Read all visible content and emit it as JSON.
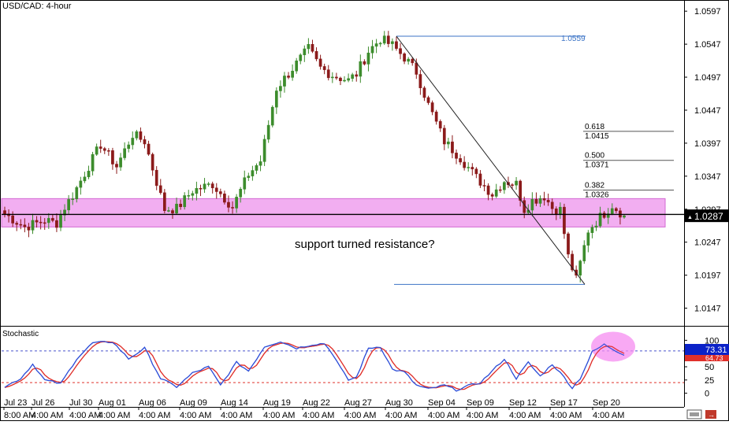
{
  "header": {
    "title": "USD/CAD: 4-hour"
  },
  "sub_panel": {
    "title": "Stochastic"
  },
  "annotation": "support turned resistance?",
  "colors": {
    "bull": "#3c8c2c",
    "bear": "#8b1a1a",
    "zone": "#f0a0ef",
    "zone_border": "#d36ad3",
    "fib_line": "#555555",
    "swing_line": "#3b73c6",
    "stoch_k": "#2f4fd8",
    "stoch_d": "#e0302a",
    "ob_line": "#4a55cc",
    "os_line": "#e0302a",
    "price_label_bg": "#000000",
    "k_label_bg": "#0b22c8",
    "d_label_bg": "#e0302a",
    "circle": "#f58cf0"
  },
  "chart_data": [
    {
      "type": "candlestick",
      "title": "USD/CAD: 4-hour",
      "y_ticks": [
        "1.0597",
        "1.0547",
        "1.0497",
        "1.0447",
        "1.0397",
        "1.0347",
        "1.0297",
        "1.0247",
        "1.0197",
        "1.0147"
      ],
      "ylim": [
        1.0125,
        1.0602
      ],
      "current_price": "1.0287",
      "support_resistance_line": 1.0289,
      "support_zone": [
        1.027,
        1.0313
      ],
      "swing_high": {
        "label": "1.0559",
        "value": 1.0559
      },
      "swing_low": {
        "value": 1.0183
      },
      "fibonacci": [
        {
          "ratio": "0.618",
          "price": "1.0415"
        },
        {
          "ratio": "0.500",
          "price": "1.0371"
        },
        {
          "ratio": "0.382",
          "price": "1.0326"
        }
      ],
      "x_dates": [
        "Jul 23",
        "Jul 26",
        "Jul 30",
        "Aug 01",
        "Aug 06",
        "Aug 09",
        "Aug 14",
        "Aug 19",
        "Aug 22",
        "Aug 27",
        "Aug 30",
        "Sep 04",
        "Sep 09",
        "Sep 12",
        "Sep 17",
        "Sep 20"
      ],
      "x_times": [
        "8:00 AM",
        "4:00 AM",
        "4:00 AM",
        "4:00 AM",
        "4:00 AM",
        "4:00 AM",
        "4:00 AM",
        "4:00 AM",
        "4:00 AM",
        "4:00 AM",
        "4:00 AM",
        "4:00 AM",
        "4:00 AM",
        "4:00 AM",
        "4:00 AM",
        "4:00 AM"
      ],
      "path_waypoints": [
        [
          0,
          1.029
        ],
        [
          5,
          1.027
        ],
        [
          10,
          1.028
        ],
        [
          13,
          1.0276
        ],
        [
          15,
          1.03
        ],
        [
          17,
          1.0318
        ],
        [
          24,
          1.0395
        ],
        [
          28,
          1.0362
        ],
        [
          32,
          1.041
        ],
        [
          35,
          1.04
        ],
        [
          40,
          1.0297
        ],
        [
          43,
          1.0298
        ],
        [
          47,
          1.0325
        ],
        [
          52,
          1.0335
        ],
        [
          57,
          1.03
        ],
        [
          61,
          1.035
        ],
        [
          64,
          1.037
        ],
        [
          68,
          1.048
        ],
        [
          72,
          1.051
        ],
        [
          76,
          1.054
        ],
        [
          79,
          1.0511
        ],
        [
          82,
          1.05
        ],
        [
          86,
          1.0492
        ],
        [
          88,
          1.0502
        ],
        [
          91,
          1.0536
        ],
        [
          94,
          1.0555
        ],
        [
          97,
          1.0545
        ],
        [
          100,
          1.0527
        ],
        [
          103,
          1.0505
        ],
        [
          106,
          1.0455
        ],
        [
          110,
          1.04
        ],
        [
          114,
          1.0375
        ],
        [
          118,
          1.0345
        ],
        [
          122,
          1.032
        ],
        [
          125,
          1.034
        ],
        [
          128,
          1.0335
        ],
        [
          130,
          1.0297
        ],
        [
          132,
          1.031
        ],
        [
          135,
          1.0317
        ],
        [
          137,
          1.0299
        ],
        [
          139,
          1.0296
        ],
        [
          141,
          1.0225
        ],
        [
          143,
          1.019
        ],
        [
          146,
          1.0265
        ],
        [
          149,
          1.0285
        ],
        [
          152,
          1.0303
        ],
        [
          155,
          1.0287
        ]
      ]
    },
    {
      "type": "line",
      "title": "Stochastic",
      "y_ticks": [
        "100",
        "50",
        "25",
        "0"
      ],
      "ylim": [
        -8,
        108
      ],
      "overbought": 80,
      "oversold": 20,
      "k_label": "73.31",
      "d_label": "64.73",
      "waypoints": [
        [
          0,
          12
        ],
        [
          4,
          28
        ],
        [
          7,
          55
        ],
        [
          10,
          25
        ],
        [
          14,
          18
        ],
        [
          18,
          65
        ],
        [
          22,
          95
        ],
        [
          27,
          97
        ],
        [
          31,
          65
        ],
        [
          35,
          85
        ],
        [
          39,
          28
        ],
        [
          43,
          12
        ],
        [
          47,
          38
        ],
        [
          51,
          50
        ],
        [
          54,
          15
        ],
        [
          58,
          58
        ],
        [
          61,
          42
        ],
        [
          65,
          88
        ],
        [
          69,
          98
        ],
        [
          73,
          85
        ],
        [
          77,
          92
        ],
        [
          80,
          94
        ],
        [
          82,
          75
        ],
        [
          84,
          48
        ],
        [
          86,
          25
        ],
        [
          88,
          30
        ],
        [
          91,
          85
        ],
        [
          94,
          88
        ],
        [
          97,
          45
        ],
        [
          100,
          40
        ],
        [
          103,
          15
        ],
        [
          106,
          8
        ],
        [
          110,
          15
        ],
        [
          113,
          6
        ],
        [
          116,
          14
        ],
        [
          119,
          20
        ],
        [
          122,
          42
        ],
        [
          125,
          65
        ],
        [
          128,
          28
        ],
        [
          131,
          58
        ],
        [
          134,
          32
        ],
        [
          137,
          55
        ],
        [
          140,
          30
        ],
        [
          142,
          10
        ],
        [
          144,
          28
        ],
        [
          147,
          78
        ],
        [
          150,
          92
        ],
        [
          153,
          80
        ],
        [
          155,
          73
        ]
      ]
    }
  ]
}
